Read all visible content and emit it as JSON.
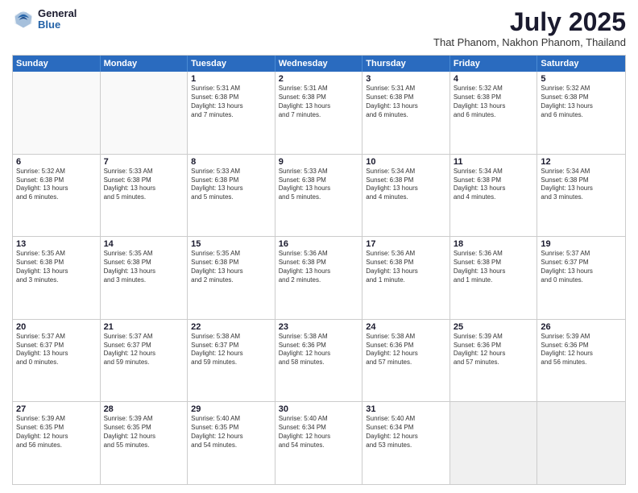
{
  "logo": {
    "general": "General",
    "blue": "Blue"
  },
  "header": {
    "month": "July 2025",
    "location": "That Phanom, Nakhon Phanom, Thailand"
  },
  "weekdays": [
    "Sunday",
    "Monday",
    "Tuesday",
    "Wednesday",
    "Thursday",
    "Friday",
    "Saturday"
  ],
  "rows": [
    [
      {
        "day": "",
        "text": "",
        "empty": true
      },
      {
        "day": "",
        "text": "",
        "empty": true
      },
      {
        "day": "1",
        "text": "Sunrise: 5:31 AM\nSunset: 6:38 PM\nDaylight: 13 hours\nand 7 minutes."
      },
      {
        "day": "2",
        "text": "Sunrise: 5:31 AM\nSunset: 6:38 PM\nDaylight: 13 hours\nand 7 minutes."
      },
      {
        "day": "3",
        "text": "Sunrise: 5:31 AM\nSunset: 6:38 PM\nDaylight: 13 hours\nand 6 minutes."
      },
      {
        "day": "4",
        "text": "Sunrise: 5:32 AM\nSunset: 6:38 PM\nDaylight: 13 hours\nand 6 minutes."
      },
      {
        "day": "5",
        "text": "Sunrise: 5:32 AM\nSunset: 6:38 PM\nDaylight: 13 hours\nand 6 minutes."
      }
    ],
    [
      {
        "day": "6",
        "text": "Sunrise: 5:32 AM\nSunset: 6:38 PM\nDaylight: 13 hours\nand 6 minutes."
      },
      {
        "day": "7",
        "text": "Sunrise: 5:33 AM\nSunset: 6:38 PM\nDaylight: 13 hours\nand 5 minutes."
      },
      {
        "day": "8",
        "text": "Sunrise: 5:33 AM\nSunset: 6:38 PM\nDaylight: 13 hours\nand 5 minutes."
      },
      {
        "day": "9",
        "text": "Sunrise: 5:33 AM\nSunset: 6:38 PM\nDaylight: 13 hours\nand 5 minutes."
      },
      {
        "day": "10",
        "text": "Sunrise: 5:34 AM\nSunset: 6:38 PM\nDaylight: 13 hours\nand 4 minutes."
      },
      {
        "day": "11",
        "text": "Sunrise: 5:34 AM\nSunset: 6:38 PM\nDaylight: 13 hours\nand 4 minutes."
      },
      {
        "day": "12",
        "text": "Sunrise: 5:34 AM\nSunset: 6:38 PM\nDaylight: 13 hours\nand 3 minutes."
      }
    ],
    [
      {
        "day": "13",
        "text": "Sunrise: 5:35 AM\nSunset: 6:38 PM\nDaylight: 13 hours\nand 3 minutes."
      },
      {
        "day": "14",
        "text": "Sunrise: 5:35 AM\nSunset: 6:38 PM\nDaylight: 13 hours\nand 3 minutes."
      },
      {
        "day": "15",
        "text": "Sunrise: 5:35 AM\nSunset: 6:38 PM\nDaylight: 13 hours\nand 2 minutes."
      },
      {
        "day": "16",
        "text": "Sunrise: 5:36 AM\nSunset: 6:38 PM\nDaylight: 13 hours\nand 2 minutes."
      },
      {
        "day": "17",
        "text": "Sunrise: 5:36 AM\nSunset: 6:38 PM\nDaylight: 13 hours\nand 1 minute."
      },
      {
        "day": "18",
        "text": "Sunrise: 5:36 AM\nSunset: 6:38 PM\nDaylight: 13 hours\nand 1 minute."
      },
      {
        "day": "19",
        "text": "Sunrise: 5:37 AM\nSunset: 6:37 PM\nDaylight: 13 hours\nand 0 minutes."
      }
    ],
    [
      {
        "day": "20",
        "text": "Sunrise: 5:37 AM\nSunset: 6:37 PM\nDaylight: 13 hours\nand 0 minutes."
      },
      {
        "day": "21",
        "text": "Sunrise: 5:37 AM\nSunset: 6:37 PM\nDaylight: 12 hours\nand 59 minutes."
      },
      {
        "day": "22",
        "text": "Sunrise: 5:38 AM\nSunset: 6:37 PM\nDaylight: 12 hours\nand 59 minutes."
      },
      {
        "day": "23",
        "text": "Sunrise: 5:38 AM\nSunset: 6:36 PM\nDaylight: 12 hours\nand 58 minutes."
      },
      {
        "day": "24",
        "text": "Sunrise: 5:38 AM\nSunset: 6:36 PM\nDaylight: 12 hours\nand 57 minutes."
      },
      {
        "day": "25",
        "text": "Sunrise: 5:39 AM\nSunset: 6:36 PM\nDaylight: 12 hours\nand 57 minutes."
      },
      {
        "day": "26",
        "text": "Sunrise: 5:39 AM\nSunset: 6:36 PM\nDaylight: 12 hours\nand 56 minutes."
      }
    ],
    [
      {
        "day": "27",
        "text": "Sunrise: 5:39 AM\nSunset: 6:35 PM\nDaylight: 12 hours\nand 56 minutes."
      },
      {
        "day": "28",
        "text": "Sunrise: 5:39 AM\nSunset: 6:35 PM\nDaylight: 12 hours\nand 55 minutes."
      },
      {
        "day": "29",
        "text": "Sunrise: 5:40 AM\nSunset: 6:35 PM\nDaylight: 12 hours\nand 54 minutes."
      },
      {
        "day": "30",
        "text": "Sunrise: 5:40 AM\nSunset: 6:34 PM\nDaylight: 12 hours\nand 54 minutes."
      },
      {
        "day": "31",
        "text": "Sunrise: 5:40 AM\nSunset: 6:34 PM\nDaylight: 12 hours\nand 53 minutes."
      },
      {
        "day": "",
        "text": "",
        "empty": true,
        "shaded": true
      },
      {
        "day": "",
        "text": "",
        "empty": true,
        "shaded": true
      }
    ]
  ]
}
